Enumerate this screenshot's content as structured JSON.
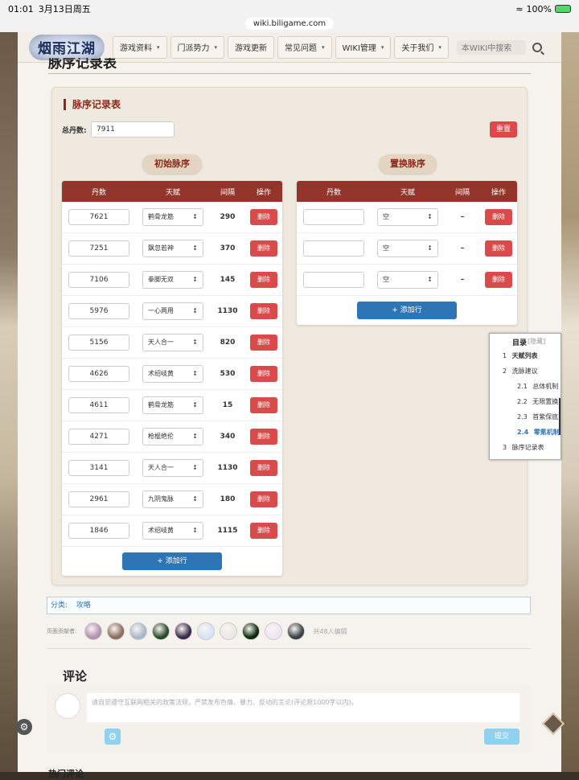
{
  "status": {
    "time": "01:01",
    "date": "3月13日周五",
    "battery": "100%"
  },
  "url": "wiki.biligame.com",
  "nav": {
    "logo": "烟雨江湖",
    "items": [
      {
        "label": "游戏资料",
        "caret": true
      },
      {
        "label": "门派势力",
        "caret": true
      },
      {
        "label": "游戏更新",
        "caret": false
      },
      {
        "label": "常见问题",
        "caret": true
      },
      {
        "label": "WIKI管理",
        "caret": true
      },
      {
        "label": "关于我们",
        "caret": true
      }
    ],
    "search_placeholder": "本WIKI中搜索"
  },
  "page_title": "脉序记录表",
  "card": {
    "title": "脉序记录表",
    "total_label": "总丹数:",
    "total_value": "7911",
    "reset_label": "重置"
  },
  "left_table": {
    "title": "初始脉序",
    "headers": [
      "丹数",
      "天赋",
      "间隔",
      "操作"
    ],
    "rows": [
      {
        "dan": "7621",
        "talent": "鹤骨龙筋",
        "gap": "290"
      },
      {
        "dan": "7251",
        "talent": "飘忽若神",
        "gap": "370"
      },
      {
        "dan": "7106",
        "talent": "拳脚无双",
        "gap": "145"
      },
      {
        "dan": "5976",
        "talent": "一心两用",
        "gap": "1130"
      },
      {
        "dan": "5156",
        "talent": "天人合一",
        "gap": "820"
      },
      {
        "dan": "4626",
        "talent": "术绍岐黄",
        "gap": "530"
      },
      {
        "dan": "4611",
        "talent": "鹤骨龙筋",
        "gap": "15"
      },
      {
        "dan": "4271",
        "talent": "枪棍绝伦",
        "gap": "340"
      },
      {
        "dan": "3141",
        "talent": "天人合一",
        "gap": "1130"
      },
      {
        "dan": "2961",
        "talent": "九阴鬼脉",
        "gap": "180"
      },
      {
        "dan": "1846",
        "talent": "术绍岐黄",
        "gap": "1115"
      }
    ],
    "delete_label": "删除",
    "add_label": "+ 添加行"
  },
  "right_table": {
    "title": "置换脉序",
    "headers": [
      "丹数",
      "天赋",
      "间隔",
      "操作"
    ],
    "rows": [
      {
        "dan": "",
        "talent": "空",
        "gap": "–"
      },
      {
        "dan": "",
        "talent": "空",
        "gap": "–"
      },
      {
        "dan": "",
        "talent": "空",
        "gap": "–"
      }
    ],
    "delete_label": "删除",
    "add_label": "+ 添加行"
  },
  "toc": {
    "title": "目录",
    "hide": "[隐藏]",
    "items": [
      {
        "num": "1",
        "label": "天赋列表"
      },
      {
        "num": "2",
        "label": "洗脉建议"
      },
      {
        "num": "2.1",
        "label": "总体机制"
      },
      {
        "num": "2.2",
        "label": "无限置换"
      },
      {
        "num": "2.3",
        "label": "首紫保底"
      },
      {
        "num": "2.4",
        "label": "零氪机制"
      },
      {
        "num": "3",
        "label": "脉序记录表"
      }
    ]
  },
  "category": {
    "label": "分类:",
    "value": "攻略"
  },
  "contributors": {
    "label": "页面贡献者:",
    "avatar_colors": [
      "#b48fb0",
      "#8c6e5c",
      "#a9b8c9",
      "#2a4a2a",
      "#3b2a4a",
      "#d4e4f4",
      "#e8e8e8",
      "#0a2a0a",
      "#efe4f4",
      "#3a4046"
    ],
    "count": "共48人编辑"
  },
  "comments": {
    "heading": "评论",
    "placeholder": "请自觉遵守互联网相关的政策法规，严禁发布色情、暴力、反动的言论(评论限1000字以内)。",
    "submit": "提交",
    "hot": "热门评论"
  }
}
